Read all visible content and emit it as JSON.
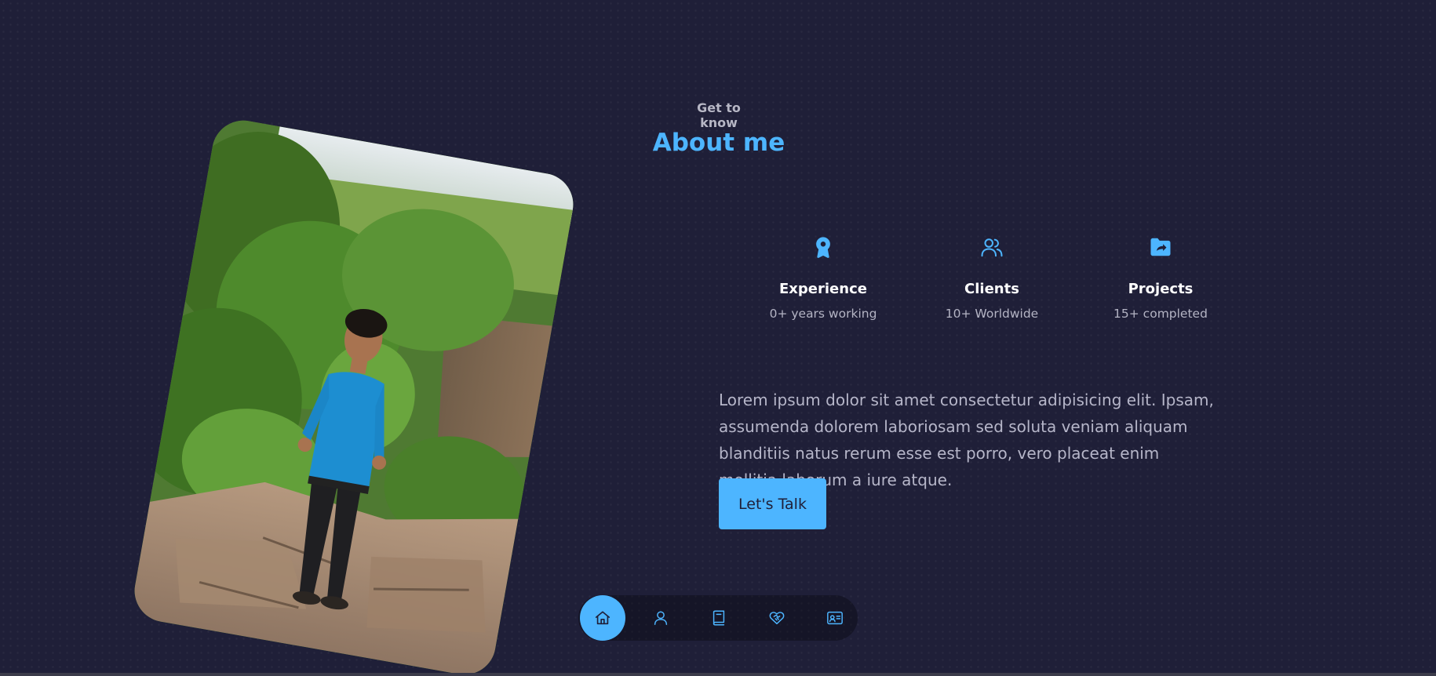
{
  "header": {
    "eyebrow": "Get to know",
    "title": "About me"
  },
  "profile_photo": {
    "icon": "profile-photo"
  },
  "cards": [
    {
      "icon": "award-icon",
      "title": "Experience",
      "subtitle": "0+ years working"
    },
    {
      "icon": "users-icon",
      "title": "Clients",
      "subtitle": "10+ Worldwide"
    },
    {
      "icon": "folder-icon",
      "title": "Projects",
      "subtitle": "15+ completed"
    }
  ],
  "about_text": "Lorem ipsum dolor sit amet consectetur adipisicing elit. Ipsam, assumenda dolorem laboriosam sed soluta veniam aliquam blanditiis natus rerum esse est porro, vero placeat enim mollitia laborum a iure atque.",
  "cta": {
    "label": "Let's Talk"
  },
  "nav": {
    "items": [
      {
        "icon": "home-icon",
        "active": true
      },
      {
        "icon": "user-icon",
        "active": false
      },
      {
        "icon": "book-icon",
        "active": false
      },
      {
        "icon": "handshake-icon",
        "active": false
      },
      {
        "icon": "contact-card-icon",
        "active": false
      }
    ]
  },
  "colors": {
    "background": "#1f1f38",
    "accent": "#4db5ff",
    "text_light": "#b6b6c9",
    "white": "#ffffff"
  }
}
